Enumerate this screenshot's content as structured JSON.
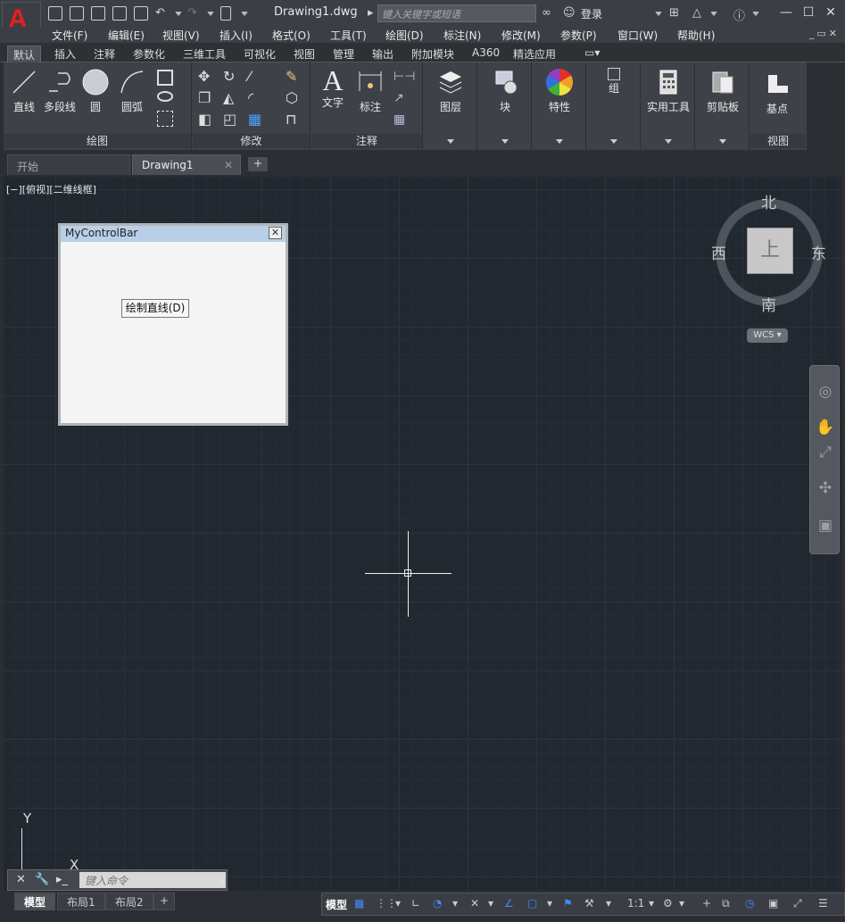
{
  "title": {
    "app_letter": "A",
    "document": "Drawing1.dwg",
    "search_placeholder": "键入关键字或短语",
    "login": "登录"
  },
  "menu": [
    "文件(F)",
    "编辑(E)",
    "视图(V)",
    "插入(I)",
    "格式(O)",
    "工具(T)",
    "绘图(D)",
    "标注(N)",
    "修改(M)",
    "参数(P)",
    "窗口(W)",
    "帮助(H)"
  ],
  "ribbon_tabs": [
    "默认",
    "插入",
    "注释",
    "参数化",
    "三维工具",
    "可视化",
    "视图",
    "管理",
    "输出",
    "附加模块",
    "A360",
    "精选应用"
  ],
  "panels": {
    "draw": {
      "title": "绘图",
      "line": "直线",
      "polyline": "多段线",
      "circle": "圆",
      "arc": "圆弧"
    },
    "modify": {
      "title": "修改"
    },
    "annotation": {
      "title": "注释",
      "text": "文字",
      "dimension": "标注"
    },
    "layers": "图层",
    "block": "块",
    "properties": "特性",
    "groups": "组",
    "utilities": "实用工具",
    "clipboard": "剪贴板",
    "view": {
      "title": "视图",
      "base": "基点"
    }
  },
  "file_tabs": {
    "start": "开始",
    "drawing": "Drawing1"
  },
  "viewport_label": "[−][俯视][二维线框]",
  "control_bar": {
    "title": "MyControlBar",
    "button": "绘制直线(D)"
  },
  "viewcube": {
    "north": "北",
    "south": "南",
    "east": "东",
    "west": "西",
    "face": "上",
    "wcs": "WCS"
  },
  "ucs": {
    "x": "X",
    "y": "Y"
  },
  "command": {
    "placeholder": "键入命令"
  },
  "layout_tabs": [
    "模型",
    "布局1",
    "布局2"
  ],
  "status": {
    "model": "模型",
    "scale": "1:1"
  },
  "colors": {
    "accent": "#3d8cff",
    "canvas": "#212830",
    "logo": "#e02020"
  }
}
